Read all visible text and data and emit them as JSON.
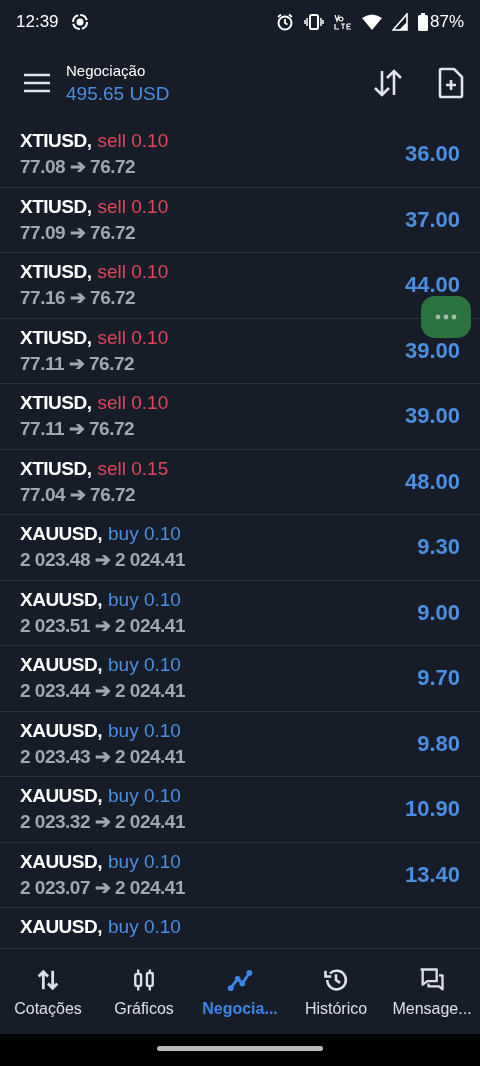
{
  "status_bar": {
    "time": "12:39",
    "battery": "87%"
  },
  "header": {
    "title": "Negociação",
    "balance": "495.65 USD"
  },
  "positions": [
    {
      "symbol": "XTIUSD,",
      "kind": "sell",
      "order": "sell 0.10",
      "prices": "77.08 ➔ 76.72",
      "profit": "36.00"
    },
    {
      "symbol": "XTIUSD,",
      "kind": "sell",
      "order": "sell 0.10",
      "prices": "77.09 ➔ 76.72",
      "profit": "37.00"
    },
    {
      "symbol": "XTIUSD,",
      "kind": "sell",
      "order": "sell 0.10",
      "prices": "77.16 ➔ 76.72",
      "profit": "44.00"
    },
    {
      "symbol": "XTIUSD,",
      "kind": "sell",
      "order": "sell 0.10",
      "prices": "77.11 ➔ 76.72",
      "profit": "39.00"
    },
    {
      "symbol": "XTIUSD,",
      "kind": "sell",
      "order": "sell 0.10",
      "prices": "77.11 ➔ 76.72",
      "profit": "39.00"
    },
    {
      "symbol": "XTIUSD,",
      "kind": "sell",
      "order": "sell 0.15",
      "prices": "77.04 ➔ 76.72",
      "profit": "48.00"
    },
    {
      "symbol": "XAUUSD,",
      "kind": "buy",
      "order": "buy 0.10",
      "prices": "2 023.48 ➔ 2 024.41",
      "profit": "9.30"
    },
    {
      "symbol": "XAUUSD,",
      "kind": "buy",
      "order": "buy 0.10",
      "prices": "2 023.51 ➔ 2 024.41",
      "profit": "9.00"
    },
    {
      "symbol": "XAUUSD,",
      "kind": "buy",
      "order": "buy 0.10",
      "prices": "2 023.44 ➔ 2 024.41",
      "profit": "9.70"
    },
    {
      "symbol": "XAUUSD,",
      "kind": "buy",
      "order": "buy 0.10",
      "prices": "2 023.43 ➔ 2 024.41",
      "profit": "9.80"
    },
    {
      "symbol": "XAUUSD,",
      "kind": "buy",
      "order": "buy 0.10",
      "prices": "2 023.32 ➔ 2 024.41",
      "profit": "10.90"
    },
    {
      "symbol": "XAUUSD,",
      "kind": "buy",
      "order": "buy 0.10",
      "prices": "2 023.07 ➔ 2 024.41",
      "profit": "13.40"
    },
    {
      "symbol": "XAUUSD,",
      "kind": "buy",
      "order": "buy 0.10"
    }
  ],
  "nav": [
    {
      "kind": "quotes",
      "label": "Cotações",
      "selected": false
    },
    {
      "kind": "charts",
      "label": "Gráficos",
      "selected": false
    },
    {
      "kind": "trade",
      "label": "Negocia...",
      "selected": true
    },
    {
      "kind": "history",
      "label": "Histórico",
      "selected": false
    },
    {
      "kind": "messages",
      "label": "Mensage...",
      "selected": false
    }
  ]
}
